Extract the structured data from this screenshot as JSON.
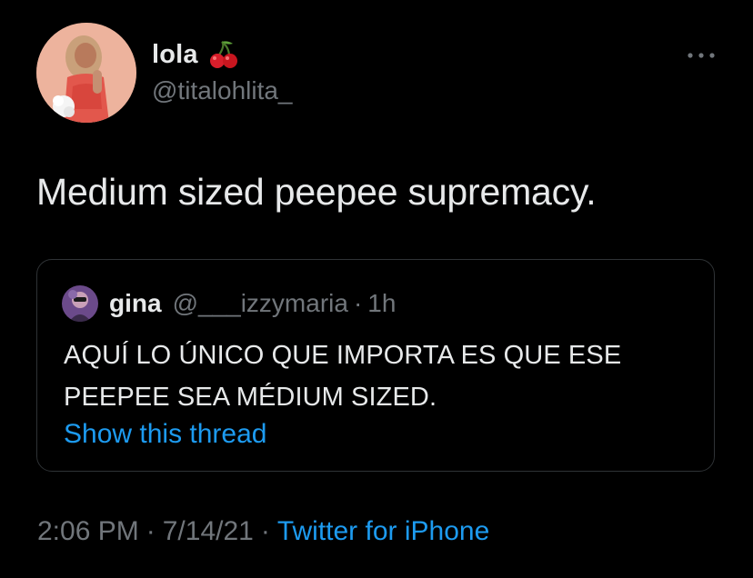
{
  "tweet": {
    "author": {
      "display_name": "lola",
      "handle": "@titalohlita_",
      "avatar_icon": "profile-photo",
      "name_emoji_icon": "cherry-emoji"
    },
    "more_icon": "more-horizontal-icon",
    "text": "Medium sized peepee supremacy.",
    "quoted": {
      "display_name": "gina",
      "handle": "@___izzymaria",
      "separator": "·",
      "time": "1h",
      "avatar_icon": "profile-photo",
      "text_lines": [
        "AQUÍ LO ÚNICO QUE IMPORTA ES QUE ESE",
        "PEEPEE SEA MÉDIUM SIZED."
      ],
      "show_thread_label": "Show this thread"
    },
    "meta": {
      "time": "2:06 PM",
      "separator": "·",
      "date": "7/14/21",
      "source": "Twitter for iPhone"
    }
  },
  "colors": {
    "background": "#000000",
    "primary_text": "#e7e9ea",
    "secondary_text": "#71767b",
    "link": "#1d9bf0",
    "border": "#2f3336"
  }
}
